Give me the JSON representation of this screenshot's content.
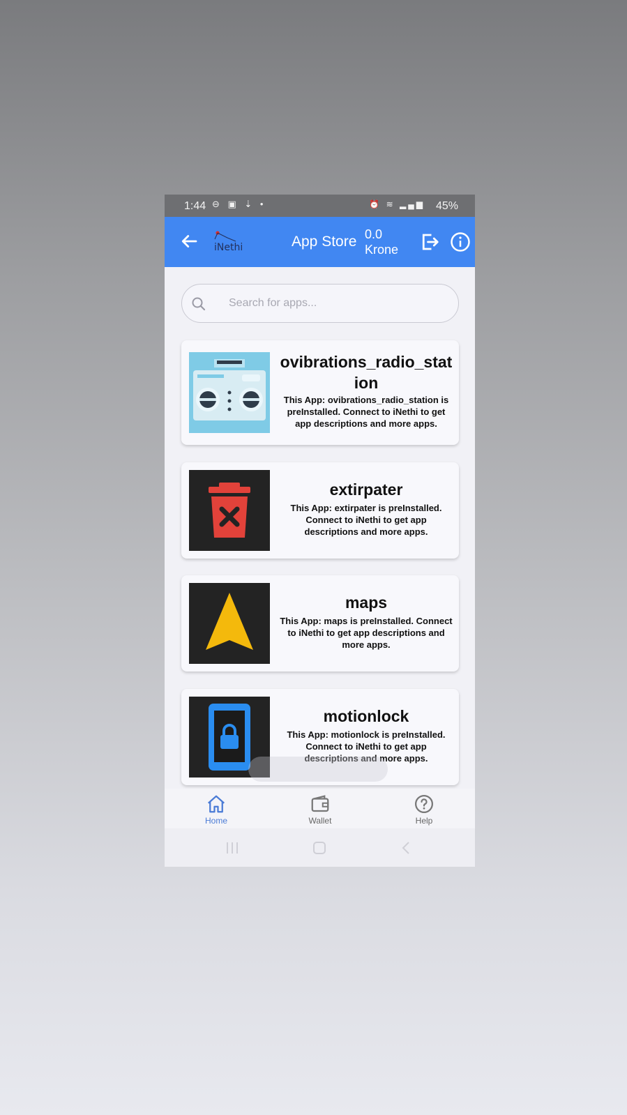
{
  "status_bar": {
    "time": "1:44",
    "battery": "45%"
  },
  "app_bar": {
    "logo_text": "iNethi",
    "title": "App Store",
    "balance_amount": "0.0",
    "balance_currency": "Krone",
    "accent_color": "#4187f2"
  },
  "search": {
    "placeholder": "Search for apps..."
  },
  "apps": [
    {
      "name": "ovibrations_radio_station",
      "description": "This App: ovibrations_radio_station is preInstalled. Connect to iNethi to get app descriptions and more apps.",
      "icon": "radio-icon"
    },
    {
      "name": "extirpater",
      "description": "This App: extirpater is preInstalled. Connect to iNethi to get app descriptions and more apps.",
      "icon": "trash-x-icon"
    },
    {
      "name": "maps",
      "description": "This App: maps is preInstalled. Connect to iNethi to get app descriptions and more apps.",
      "icon": "navigation-arrow-icon"
    },
    {
      "name": "motionlock",
      "description": "This App: motionlock is preInstalled. Connect to iNethi to get app descriptions and more apps.",
      "icon": "phone-lock-icon"
    }
  ],
  "bottom_nav": {
    "items": [
      {
        "label": "Home",
        "icon": "home-icon",
        "active": true
      },
      {
        "label": "Wallet",
        "icon": "wallet-icon",
        "active": false
      },
      {
        "label": "Help",
        "icon": "help-icon",
        "active": false
      }
    ]
  }
}
